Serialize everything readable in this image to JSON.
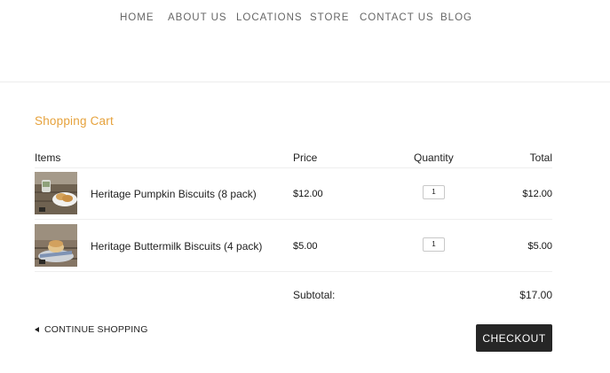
{
  "nav": {
    "items": [
      "HOME",
      "ABOUT US",
      "LOCATIONS",
      "STORE",
      "CONTACT US",
      "BLOG"
    ]
  },
  "cart": {
    "title": "Shopping Cart",
    "headers": {
      "items": "Items",
      "price": "Price",
      "quantity": "Quantity",
      "total": "Total"
    },
    "rows": [
      {
        "name": "Heritage Pumpkin Biscuits (8 pack)",
        "price": "$12.00",
        "quantity": "1",
        "total": "$12.00",
        "image_icon": "pumpkin-biscuits-photo"
      },
      {
        "name": "Heritage Buttermilk Biscuits (4 pack)",
        "price": "$5.00",
        "quantity": "1",
        "total": "$5.00",
        "image_icon": "buttermilk-biscuits-photo"
      }
    ],
    "subtotal_label": "Subtotal:",
    "subtotal_value": "$17.00",
    "continue_label": "CONTINUE SHOPPING",
    "checkout_label": "CHECKOUT"
  },
  "colors": {
    "accent": "#e6a23c",
    "checkout_bg": "#262626",
    "nav_text": "#666666"
  }
}
